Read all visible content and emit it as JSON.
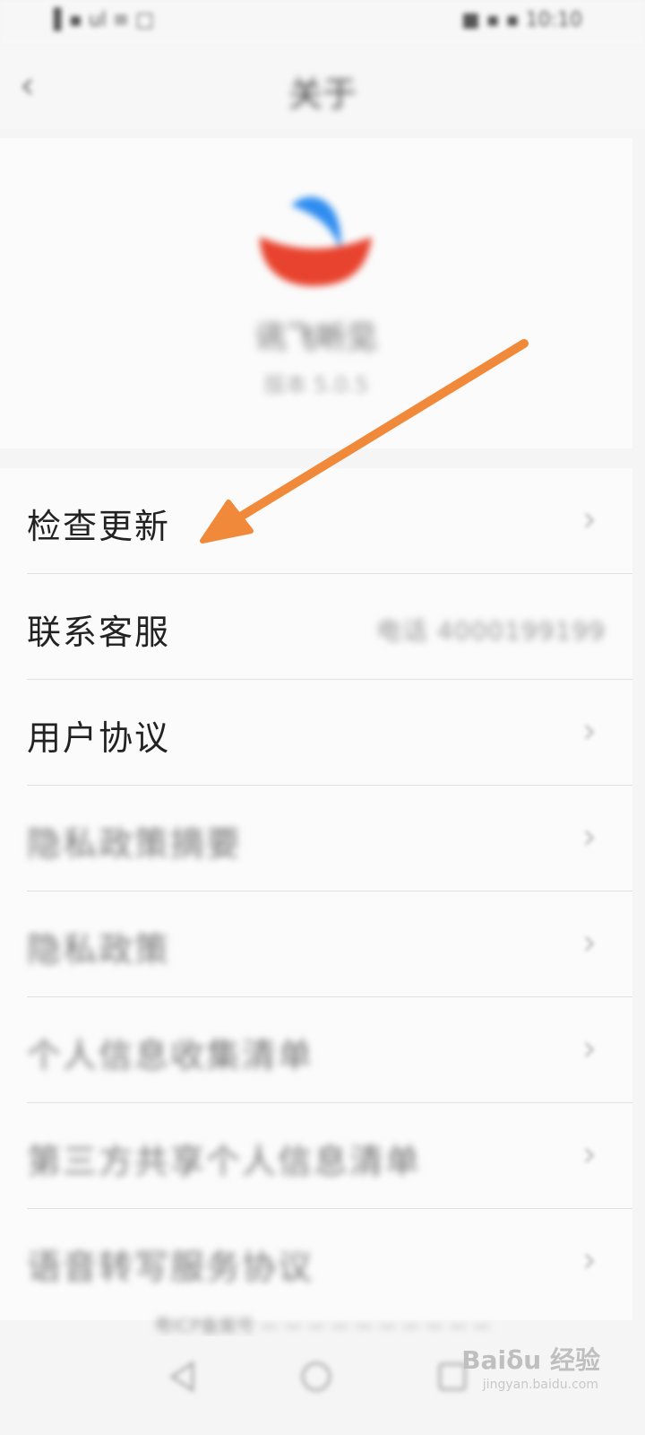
{
  "status_bar": {
    "left": "▌▪ ul ≡ □",
    "right": "■ ▪ ▪ 10:10"
  },
  "nav": {
    "title": "关于",
    "back": "‹"
  },
  "app": {
    "name": "讯飞听见",
    "version": "版本 5.0.5"
  },
  "menu": {
    "items": [
      {
        "label": "检查更新"
      },
      {
        "label": "联系客服",
        "value": "电话  4000199199"
      },
      {
        "label": "用户协议"
      },
      {
        "label": "隐私政策摘要"
      },
      {
        "label": "隐私政策"
      },
      {
        "label": "个人信息收集清单"
      },
      {
        "label": "第三方共享个人信息清单"
      },
      {
        "label": "语音转写服务协议"
      }
    ],
    "chevron": "›"
  },
  "footer": {
    "note": "粤ICP备案号 — — — — — — —  — — —"
  },
  "watermark": {
    "brand": "Baiδu 经验",
    "url": "jingyan.baidu.com"
  },
  "colors": {
    "arrow": "#f08a3a",
    "logo_red": "#e8432e",
    "logo_blue": "#2f8df0"
  }
}
